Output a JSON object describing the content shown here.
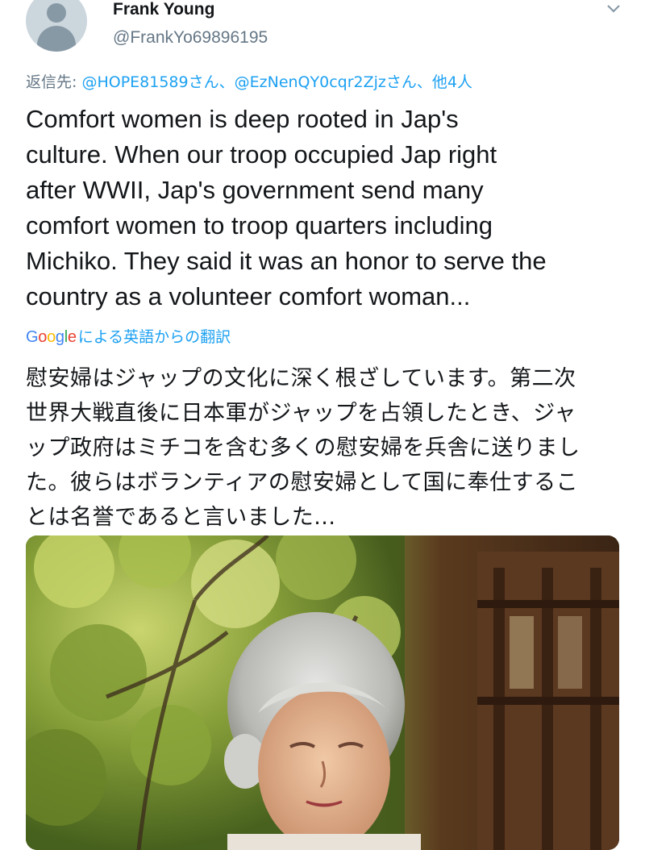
{
  "author": {
    "name": "Frank Young",
    "handle": "@FrankYo69896195",
    "avatar_icon": "default-profile-icon"
  },
  "menu_icon": "chevron-down-icon",
  "replying": {
    "prefix": "返信先: ",
    "user1": "@HOPE81589",
    "sep1": "さん、",
    "user2": "@EzNenQY0cqr2Zjz",
    "sep2": "さん、",
    "others": "他4人"
  },
  "tweet_text": "Comfort women is deep rooted in Jap's\nculture. When our troop occupied Jap right\nafter WWII, Jap's government send many\ncomfort women to troop quarters including\nMichiko. They said it was an honor to serve the\ncountry as a volunteer comfort woman...",
  "translation": {
    "provider_logo": "Google",
    "label": "による英語からの翻訳",
    "text": "慰安婦はジャップの文化に深く根ざしています。第二次\n世界大戦直後に日本軍がジャップを占領したとき、ジャ\nップ政府はミチコを含む多くの慰安婦を兵舎に送りまし\nた。彼らはボランティアの慰安婦として国に奉仕するこ\nとは名誉であると言いました..."
  },
  "media": {
    "description_icon": "photo-elderly-woman-garden"
  },
  "colors": {
    "link": "#1da1f2",
    "secondary_text": "#657786",
    "primary_text": "#14171a"
  }
}
